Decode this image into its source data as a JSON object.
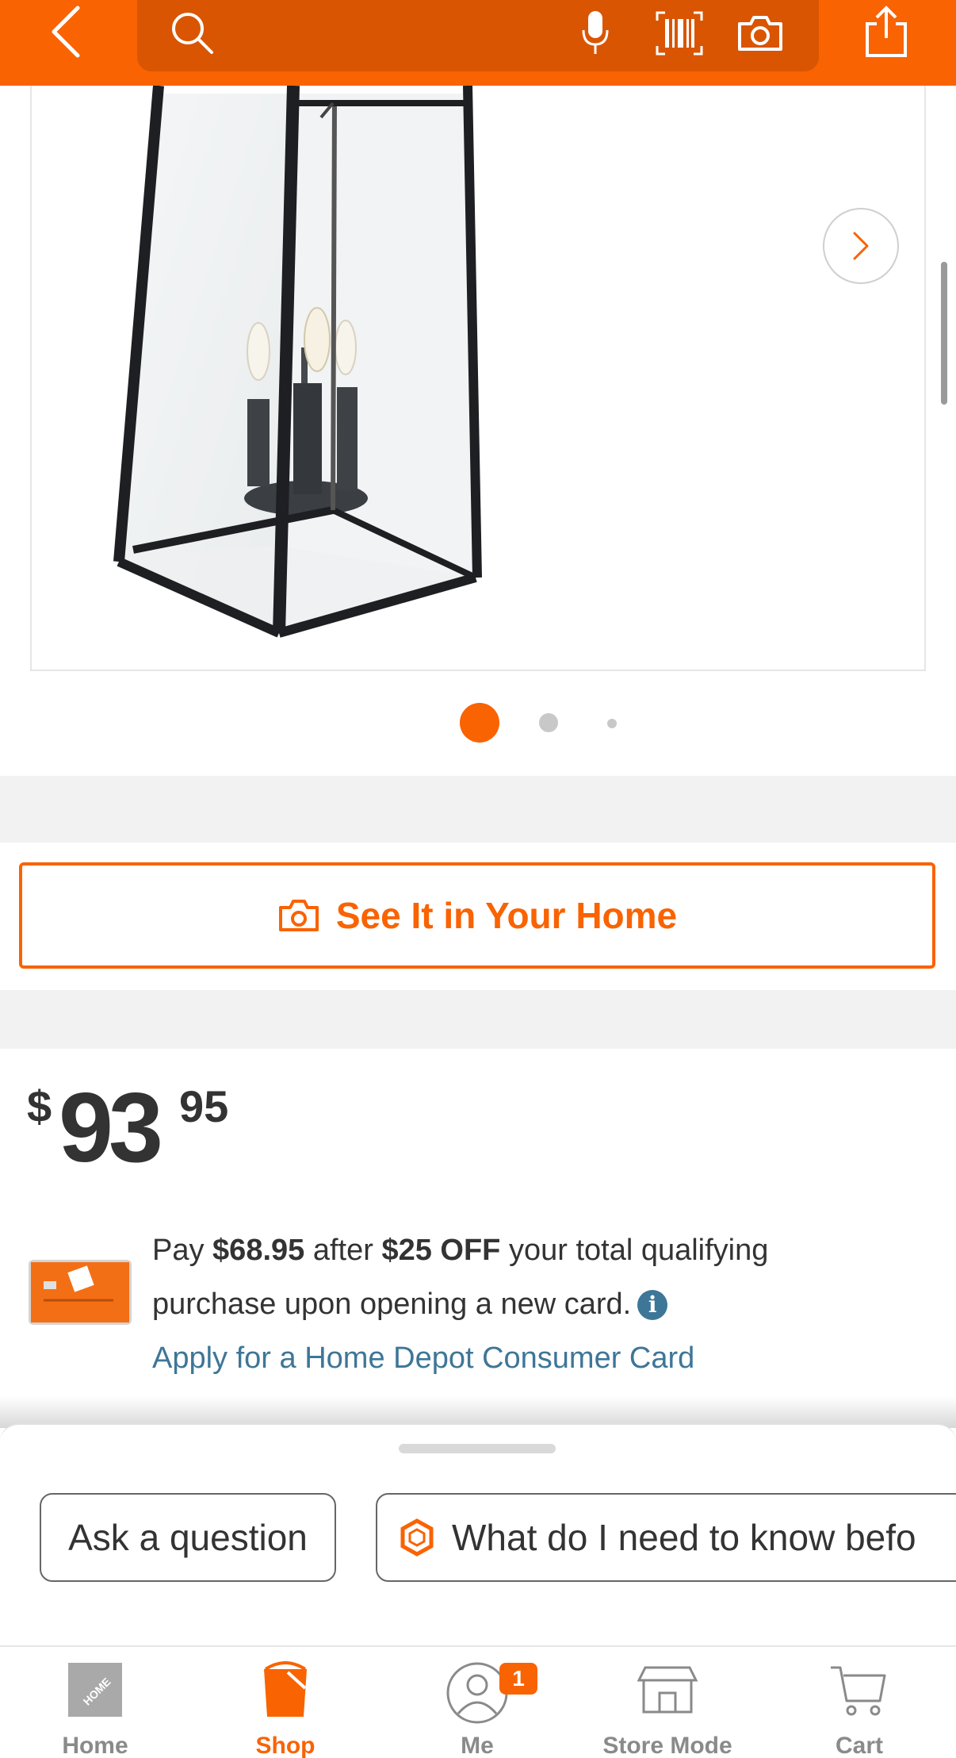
{
  "header": {
    "back_icon": "chevron-left-icon",
    "search_icon": "search-icon",
    "mic_icon": "microphone-icon",
    "barcode_icon": "barcode-icon",
    "camera_icon": "camera-icon",
    "share_icon": "share-icon",
    "brand_color": "#f96302"
  },
  "gallery": {
    "next_icon": "chevron-right-icon",
    "dots": [
      {
        "active": true
      },
      {
        "active": false
      },
      {
        "active": false
      }
    ]
  },
  "see_it": {
    "label": "See It in Your Home",
    "icon": "ar-camera-icon"
  },
  "price": {
    "dollar_sign": "$",
    "whole": "93",
    "cents": "95"
  },
  "credit_offer": {
    "pay_prefix": "Pay",
    "pay_amount": "$68.95",
    "after": "after",
    "discount": "$25 OFF",
    "rest_line1": "your total qualifying",
    "line2": "purchase upon opening a new card.",
    "info_glyph": "i",
    "apply_link": "Apply for a Home Depot Consumer Card"
  },
  "assistant": {
    "ask_label": "Ask a question",
    "know_label": "What do I need to know befo"
  },
  "bottom_nav": {
    "items": [
      {
        "label": "Home",
        "icon": "home-depot-logo-icon",
        "active": false
      },
      {
        "label": "Shop",
        "icon": "shop-bucket-icon",
        "active": true
      },
      {
        "label": "Me",
        "icon": "user-icon",
        "active": false,
        "badge": "1"
      },
      {
        "label": "Store Mode",
        "icon": "store-icon",
        "active": false
      },
      {
        "label": "Cart",
        "icon": "cart-icon",
        "active": false
      }
    ]
  }
}
